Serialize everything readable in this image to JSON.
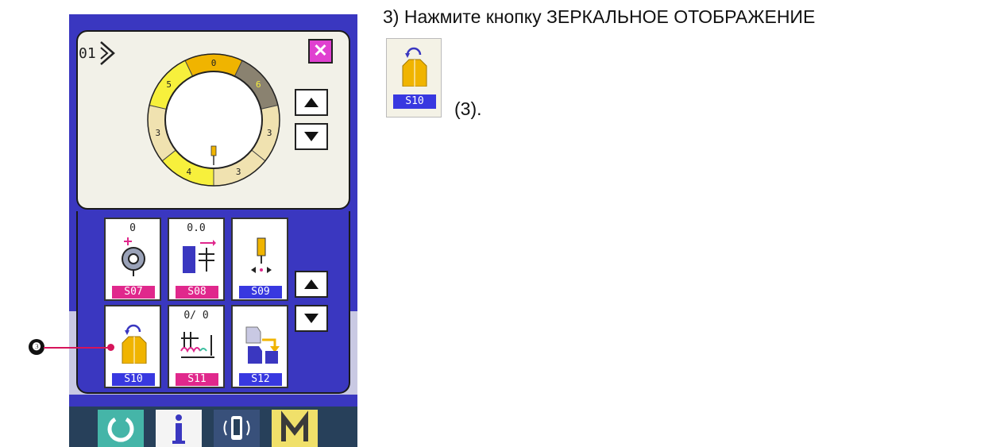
{
  "instruction": {
    "text": "3) Нажмите кнопку ЗЕРКАЛЬНОЕ ОТОБРАЖЕНИЕ",
    "ref_icon_code": "S10",
    "ref_suffix": "(3)."
  },
  "callout": {
    "marker": "❸"
  },
  "panel": {
    "pattern_number": "01",
    "close_icon": "x-icon",
    "ring_segments": [
      {
        "label": "0",
        "color": "#f0b400"
      },
      {
        "label": "6",
        "color": "#8a8270"
      },
      {
        "label": "3",
        "color": "#f0e2b0"
      },
      {
        "label": "3",
        "color": "#f0e2b0"
      },
      {
        "label": "4",
        "color": "#f7f03c"
      },
      {
        "label": "3",
        "color": "#f0e2b0"
      },
      {
        "label": "5",
        "color": "#f7f03c"
      }
    ],
    "scroll_up_icon": "triangle-up-icon",
    "scroll_down_icon": "triangle-down-icon"
  },
  "tiles": [
    {
      "value": "0",
      "code": "S07",
      "icon": "thread-tension-icon",
      "code_color": "pink"
    },
    {
      "value": "0.0",
      "code": "S08",
      "icon": "feed-adjust-icon",
      "code_color": "pink"
    },
    {
      "value": "",
      "code": "S09",
      "icon": "needle-position-icon",
      "code_color": "blue"
    },
    {
      "value": "",
      "code": "S10",
      "icon": "mirror-image-icon",
      "code_color": "blue"
    },
    {
      "value": "0/  0",
      "code": "S11",
      "icon": "stitch-count-icon",
      "code_color": "pink"
    },
    {
      "value": "",
      "code": "S12",
      "icon": "pattern-change-icon",
      "code_color": "blue"
    }
  ],
  "bottom_keys": [
    {
      "icon": "ready-icon",
      "color": "#45b5a8"
    },
    {
      "icon": "info-icon",
      "color": "#f4f4f4",
      "glyph": "i"
    },
    {
      "icon": "communication-icon",
      "color": "#38507a"
    },
    {
      "icon": "mode-icon",
      "color": "#f0e06a",
      "glyph": "M"
    }
  ]
}
